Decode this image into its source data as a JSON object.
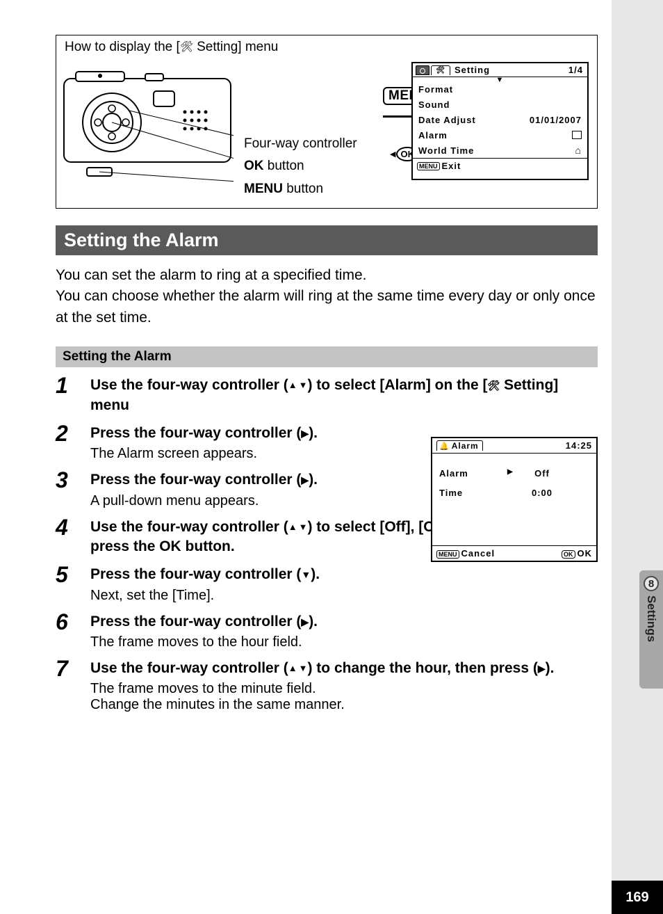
{
  "diagram": {
    "title_prefix": "How to display the [",
    "title_suffix": " Setting] menu",
    "label_fourway": "Four-way controller",
    "label_ok": " button",
    "label_ok_bold": "OK",
    "label_menu": " button",
    "label_menu_bold": "MENU",
    "menu_btn": "MENU",
    "ok_btn": "OK"
  },
  "lcd1": {
    "title": "Setting",
    "page": "1/4",
    "items": {
      "format": "Format",
      "sound": "Sound",
      "date_adjust": "Date Adjust",
      "date_value": "01/01/2007",
      "alarm": "Alarm",
      "world_time": "World Time"
    },
    "footer_menu": "MENU",
    "footer_exit": "Exit"
  },
  "section_title": "Setting the Alarm",
  "intro": "You can set the alarm to ring at a specified time.\nYou can choose whether the alarm will ring at the same time every day or only once at the set time.",
  "sub_title": "Setting the Alarm",
  "steps": {
    "s1": {
      "num": "1",
      "title_a": "Use the four-way controller (",
      "title_b": ") to select [Alarm] on the [",
      "title_c": " Setting] menu"
    },
    "s2": {
      "num": "2",
      "title_a": "Press the four-way controller (",
      "title_b": ").",
      "desc": "The Alarm screen appears."
    },
    "s3": {
      "num": "3",
      "title_a": "Press the four-way controller (",
      "title_b": ").",
      "desc": "A pull-down menu appears."
    },
    "s4": {
      "num": "4",
      "title_a": "Use the four-way controller (",
      "title_b": ") to select [Off], [Once] or [Everyday] and press the ",
      "title_c": " button.",
      "ok": "OK"
    },
    "s5": {
      "num": "5",
      "title_a": "Press the four-way controller (",
      "title_b": ").",
      "desc": "Next, set the [Time]."
    },
    "s6": {
      "num": "6",
      "title_a": "Press the four-way controller (",
      "title_b": ").",
      "desc": "The frame moves to the hour field."
    },
    "s7": {
      "num": "7",
      "title_a": "Use the four-way controller (",
      "title_b": ") to change the hour, then press (",
      "title_c": ").",
      "desc": "The frame moves to the minute field.\nChange the minutes in the same manner."
    }
  },
  "lcd2": {
    "header_label": "Alarm",
    "header_time": "14:25",
    "row_alarm_label": "Alarm",
    "row_alarm_value": "Off",
    "row_time_label": "Time",
    "row_time_value": "0:00",
    "footer_menu": "MENU",
    "footer_cancel": "Cancel",
    "footer_ok_box": "OK",
    "footer_ok": "OK"
  },
  "sidebar": {
    "chapter_num": "8",
    "chapter_label": "Settings"
  },
  "page_number": "169"
}
